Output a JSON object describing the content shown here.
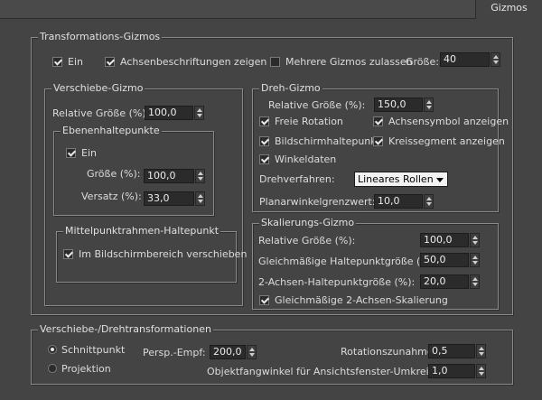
{
  "tab": {
    "label": "Gizmos"
  },
  "transform": {
    "title": "Transformations-Gizmos",
    "on_label": "Ein",
    "on_checked": true,
    "axis_labels_label": "Achsenbeschriftungen zeigen",
    "axis_labels_checked": true,
    "multi_label": "Mehrere Gizmos zulassen",
    "multi_checked": false,
    "size_label": "Größe:",
    "size_value": "40"
  },
  "move": {
    "title": "Verschiebe-Gizmo",
    "rel_size_label": "Relative Größe (%):",
    "rel_size_value": "100,0",
    "plane": {
      "title": "Ebenenhaltepunkte",
      "on_label": "Ein",
      "on_checked": true,
      "size_label": "Größe (%):",
      "size_value": "100,0",
      "offset_label": "Versatz (%):",
      "offset_value": "33,0"
    },
    "center": {
      "title": "Mittelpunktrahmen-Haltepunkt",
      "screen_label": "Im Bildschirmbereich verschieben",
      "screen_checked": true
    }
  },
  "rotate": {
    "title": "Dreh-Gizmo",
    "rel_size_label": "Relative Größe (%):",
    "rel_size_value": "150,0",
    "free_label": "Freie Rotation",
    "free_checked": true,
    "axis_symbol_label": "Achsensymbol anzeigen",
    "axis_symbol_checked": true,
    "screen_handle_label": "Bildschirmhaltepunkt",
    "screen_handle_checked": true,
    "circle_label": "Kreissegment anzeigen",
    "circle_checked": true,
    "angle_label": "Winkeldaten",
    "angle_checked": true,
    "method_label": "Drehverfahren:",
    "method_value": "Lineares Rollen",
    "planar_label": "Planarwinkelgrenzwert:",
    "planar_value": "10,0"
  },
  "scale": {
    "title": "Skalierungs-Gizmo",
    "rel_size_label": "Relative Größe (%):",
    "rel_size_value": "100,0",
    "uniform_label": "Gleichmäßige Haltepunktgröße (%) :",
    "uniform_value": "50,0",
    "twoaxis_label": "2-Achsen-Haltepunktgröße (%):",
    "twoaxis_value": "20,0",
    "twoaxis_scale_label": "Gleichmäßige 2-Achsen-Skalierung",
    "twoaxis_scale_checked": true
  },
  "movrot": {
    "title": "Verschiebe-/Drehtransformationen",
    "intersection_label": "Schnittpunkt",
    "intersection_selected": true,
    "projection_label": "Projektion",
    "projection_selected": false,
    "persp_label": "Persp.-Empf:",
    "persp_value": "200,0",
    "rot_inc_label": "Rotationszunahme:",
    "rot_inc_value": "0,5",
    "snap_label": "Objektfangwinkel für Ansichtsfenster-Umkreisung:",
    "snap_value": "1,0"
  }
}
